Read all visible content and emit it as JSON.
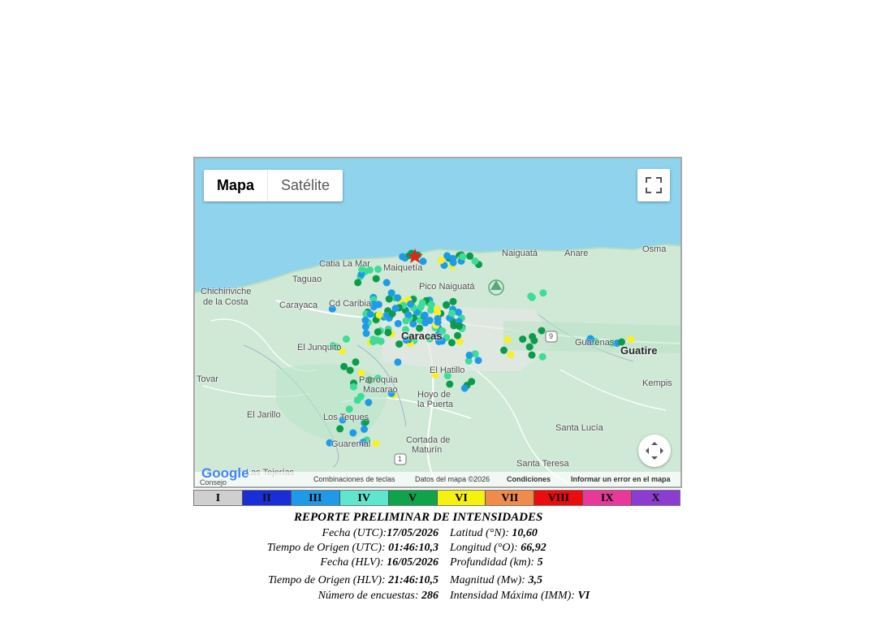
{
  "map": {
    "type_buttons": [
      "Mapa",
      "Satélite"
    ],
    "labels": {
      "catia": "Catia La Mar",
      "maiquetia": "Maiquetía",
      "naiguata": "Naiguatá",
      "anare": "Anare",
      "osma": "Osma",
      "taguao": "Taguao",
      "chichiriviche": "Chichiriviche",
      "de_la_costa": "de la Costa",
      "pico": "Pico Naiguatá",
      "carayaca": "Carayaca",
      "cd_caribia": "Cd Caribia",
      "caracas": "Caracas",
      "el_junquito": "El Junquito",
      "guarenas": "Guarenas",
      "guatire": "Guatire",
      "tovar": "Tovar",
      "parroquia": "Parroquia",
      "macarao": "Macarao",
      "el_hatillo": "El Hatillo",
      "kempis": "Kempis",
      "hoyo": "Hoyo de",
      "la_puerta": "la Puerta",
      "el_jarillo": "El Jarillo",
      "los_teques": "Los Teques",
      "santa_lucia": "Santa Lucía",
      "guaremal": "Guaremal",
      "cortada": "Cortada de",
      "maturin": "Maturín",
      "santa_teresa": "Santa Teresa",
      "las_tejerias": "Las Tejerías",
      "consejo": "Consejo",
      "route_9": "9",
      "route_1": "1"
    },
    "attribution": {
      "logo": "Google",
      "shortcuts": "Combinaciones de teclas",
      "data": "Datos del mapa ©2026",
      "terms": "Condiciones",
      "report": "Informar un error en el mapa"
    },
    "colors": {
      "sea": "#8fd3ec",
      "land": "#cfe9d6",
      "dot_blue": "#1e9be8",
      "dot_lightgreen": "#3ddc97",
      "dot_green": "#0c9b4a",
      "dot_yellow": "#f7ef2a",
      "epicenter": "#e0261c"
    }
  },
  "scale": [
    {
      "label": "I",
      "color": "#cfcfcf"
    },
    {
      "label": "II",
      "color": "#1a2ed8"
    },
    {
      "label": "III",
      "color": "#1e9be8"
    },
    {
      "label": "IV",
      "color": "#5ee6cf"
    },
    {
      "label": "V",
      "color": "#0fa34c"
    },
    {
      "label": "VI",
      "color": "#f5f20f"
    },
    {
      "label": "VII",
      "color": "#f08c4a"
    },
    {
      "label": "VIII",
      "color": "#ea0d0d"
    },
    {
      "label": "IX",
      "color": "#e8399a"
    },
    {
      "label": "X",
      "color": "#8a3dd0"
    }
  ],
  "report": {
    "title": "REPORTE PRELIMINAR DE INTENSIDADES",
    "fecha_utc_label": "Fecha (UTC):",
    "fecha_utc": "17/05/2026",
    "latitud_label": "Latitud (°N):",
    "latitud": " 10,60",
    "tiempo_utc_label": "Tiempo de Origen (UTC):",
    "tiempo_utc": " 01:46:10,3",
    "longitud_label": "Longitud (°O):",
    "longitud": " 66,92",
    "fecha_hlv_label": "Fecha (HLV):",
    "fecha_hlv": " 16/05/2026",
    "profundidad_label": "Profundidad (km):",
    "profundidad": " 5",
    "tiempo_hlv_label": "Tiempo de Origen (HLV):",
    "tiempo_hlv": " 21:46:10,5",
    "magnitud_label": "Magnitud (Mw):",
    "magnitud": " 3,5",
    "encuestas_label": "Número de encuestas:",
    "encuestas": " 286",
    "intensidad_label": "Intensidad Máxima (IMM):",
    "intensidad": " VI"
  }
}
